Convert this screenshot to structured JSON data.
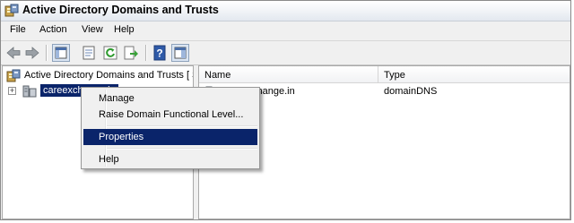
{
  "window": {
    "title": "Active Directory Domains and Trusts"
  },
  "menu": [
    "File",
    "Action",
    "View",
    "Help"
  ],
  "toolbar": {
    "buttons": [
      "back-icon",
      "forward-icon",
      "console-tree-icon",
      "properties-icon",
      "refresh-icon",
      "export-list-icon",
      "help-icon",
      "show-hide-pane-icon"
    ]
  },
  "tree": {
    "root_label": "Active Directory Domains and Trusts [ S",
    "child_label": "careexchange.in"
  },
  "list": {
    "columns": [
      "Name",
      "Type"
    ],
    "rows": [
      {
        "name": "careexchange.in",
        "type": "domainDNS"
      }
    ]
  },
  "context_menu": {
    "items": [
      "Manage",
      "Raise Domain Functional Level...",
      "Properties",
      "Help"
    ],
    "highlighted": "Properties"
  },
  "colors": {
    "selection": "#0a246a",
    "window_bg": "#f0f0f0"
  }
}
